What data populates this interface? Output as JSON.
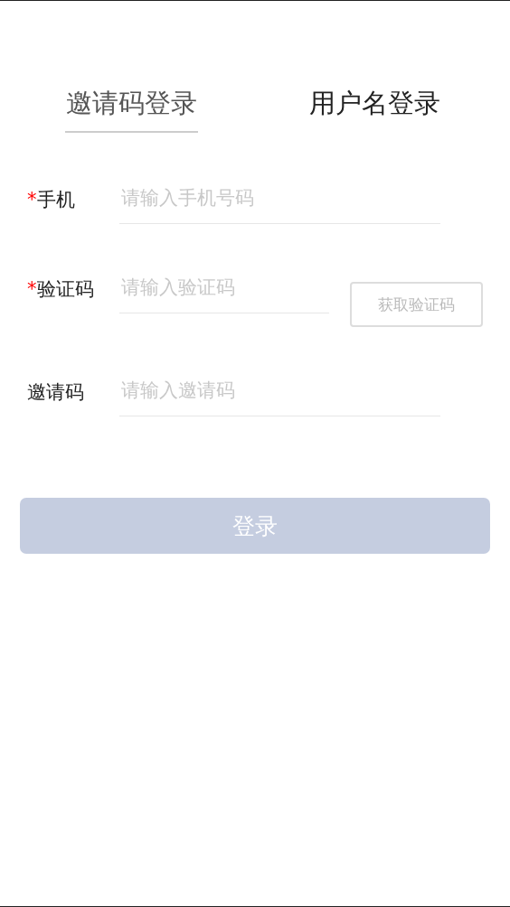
{
  "tabs": [
    {
      "label": "邀请码登录",
      "selected": true
    },
    {
      "label": "用户名登录",
      "selected": false
    }
  ],
  "fields": [
    {
      "kind": "text",
      "required_mark": "*",
      "label": "手机",
      "placeholder": "请输入手机号码"
    },
    {
      "kind": "code",
      "required_mark": "*",
      "label": "验证码",
      "placeholder": "请输入验证码",
      "button": "获取验证码"
    },
    {
      "kind": "text",
      "label": "邀请码",
      "placeholder": "请输入邀请码"
    }
  ],
  "submit": {
    "label": "登录",
    "disabled": true
  }
}
